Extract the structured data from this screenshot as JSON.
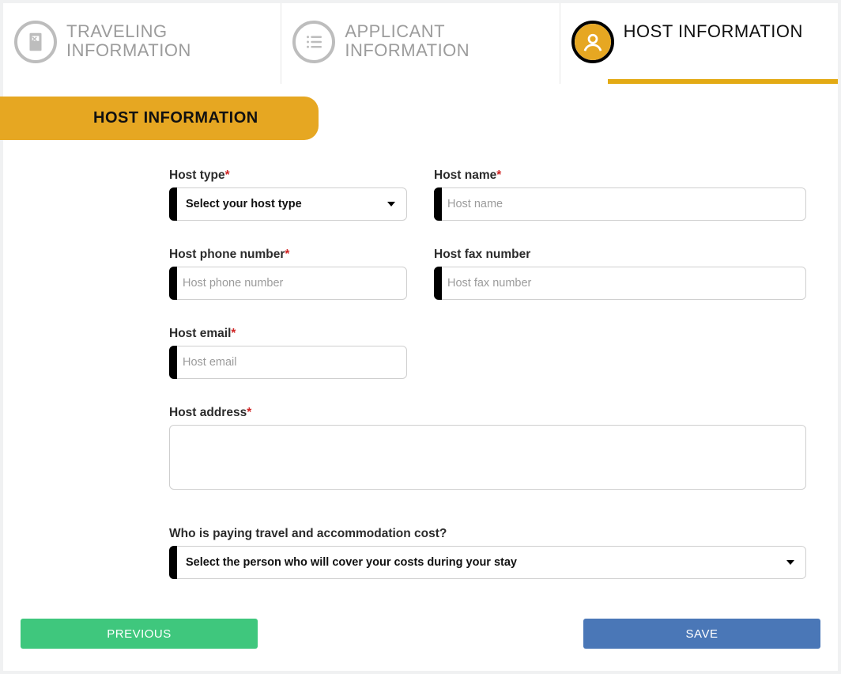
{
  "tabs": {
    "traveling": "TRAVELING INFORMATION",
    "applicant": "APPLICANT INFORMATION",
    "host": "HOST INFORMATION"
  },
  "section_title": "HOST INFORMATION",
  "labels": {
    "host_type": "Host type",
    "host_name": "Host name",
    "host_phone": "Host phone number",
    "host_fax": "Host fax number",
    "host_email": "Host email",
    "host_address": "Host address",
    "payer": "Who is paying travel and accommodation cost?"
  },
  "placeholders": {
    "host_type_select": "Select your host type",
    "host_name": "Host name",
    "host_phone": "Host phone number",
    "host_fax": "Host fax number",
    "host_email": "Host email",
    "payer_select": "Select the person who will cover your costs during your stay"
  },
  "buttons": {
    "previous": "PREVIOUS",
    "save": "SAVE"
  },
  "colors": {
    "accent": "#e6a722",
    "prev": "#3fc77d",
    "save": "#4a77b7"
  }
}
